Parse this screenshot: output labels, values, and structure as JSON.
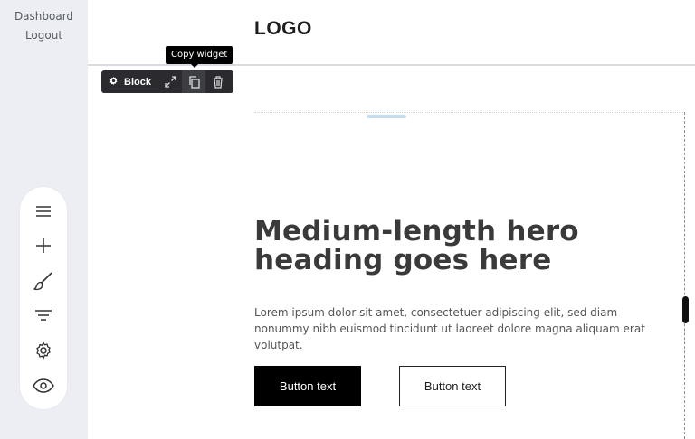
{
  "sidebar": {
    "links": [
      {
        "label": "Dashboard"
      },
      {
        "label": "Logout"
      }
    ],
    "tools": [
      {
        "icon": "menu-icon"
      },
      {
        "icon": "plus-icon"
      },
      {
        "icon": "brush-icon"
      },
      {
        "icon": "filter-icon"
      },
      {
        "icon": "gear-icon"
      },
      {
        "icon": "eye-icon"
      }
    ]
  },
  "header": {
    "logo": "LOGO"
  },
  "block_toolbar": {
    "block_label": "Block",
    "tooltip": "Copy widget",
    "icons": [
      "gear-icon",
      "expand-icon",
      "copy-icon",
      "trash-icon"
    ]
  },
  "hero": {
    "heading": "Medium-length hero heading goes here",
    "body": "Lorem ipsum dolor sit amet, consectetuer adipiscing elit, sed diam nonummy nibh euismod tincidunt ut laoreet dolore magna aliquam erat volutpat.",
    "primary_button": "Button text",
    "secondary_button": "Button text"
  },
  "colors": {
    "sidebar_bg": "#eceef3",
    "toolbar_bg": "#2b2b2f",
    "primary_button_bg": "#000000",
    "heading_color": "#3a3a3a"
  }
}
